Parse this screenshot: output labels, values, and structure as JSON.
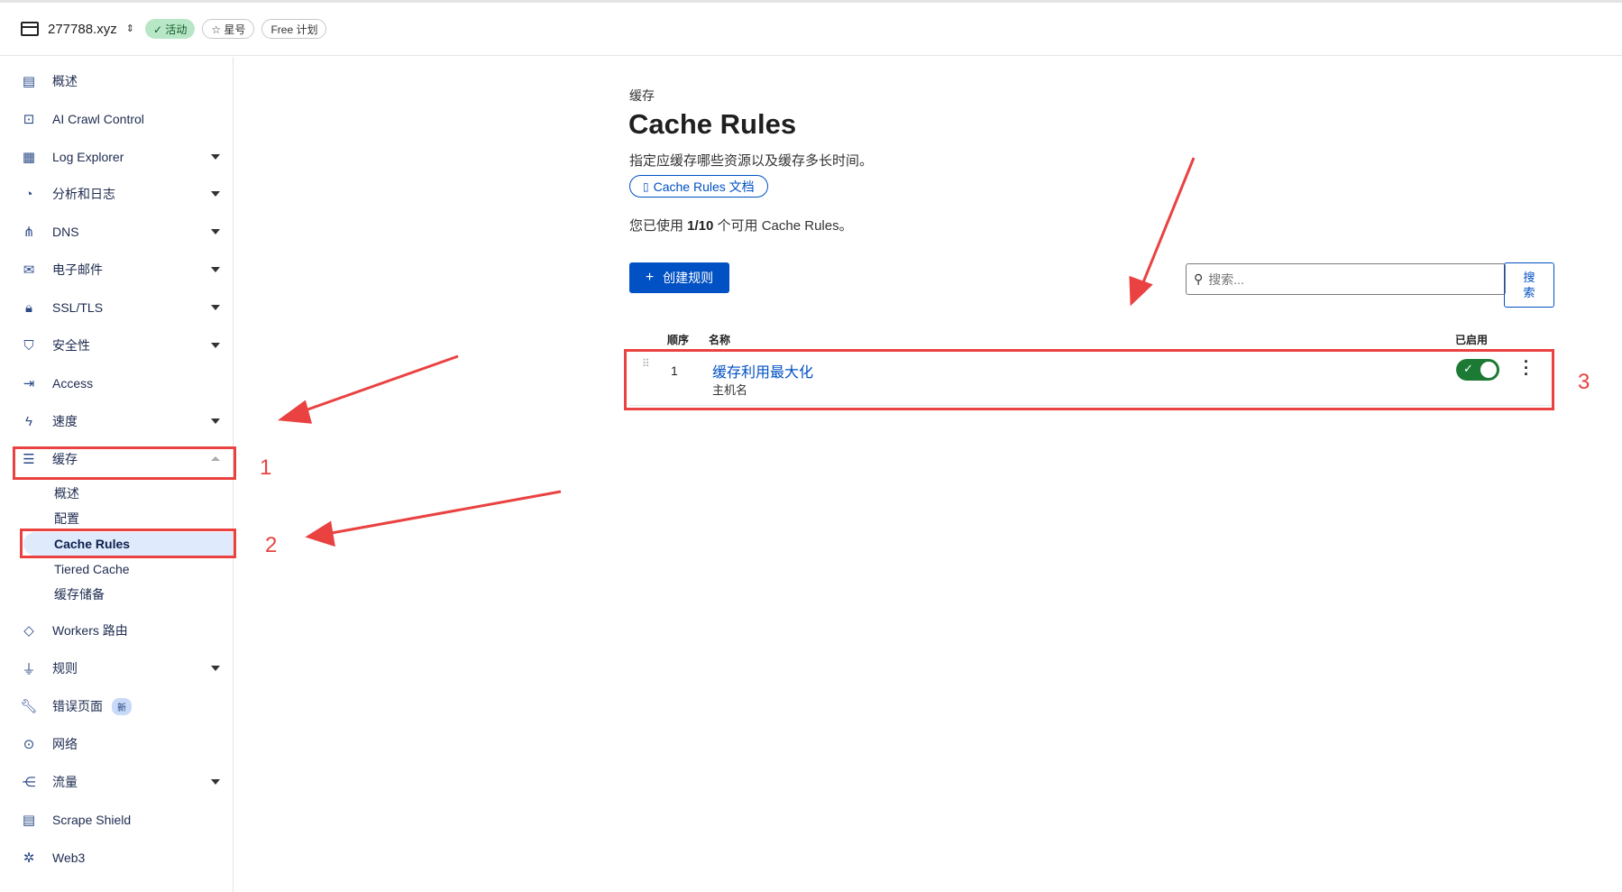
{
  "topbar": {
    "zone_name": "277788.xyz",
    "status_badge": "✓ 活动",
    "star_badge": "☆ 星号",
    "plan_badge": "Free 计划"
  },
  "sidebar": {
    "items": [
      {
        "label": "概述",
        "icon": "document-icon"
      },
      {
        "label": "AI Crawl Control",
        "icon": "robot-icon"
      },
      {
        "label": "Log Explorer",
        "icon": "log-icon"
      },
      {
        "label": "分析和日志",
        "icon": "chart-icon"
      },
      {
        "label": "DNS",
        "icon": "network-icon"
      },
      {
        "label": "电子邮件",
        "icon": "email-icon"
      },
      {
        "label": "SSL/TLS",
        "icon": "lock-icon"
      },
      {
        "label": "安全性",
        "icon": "shield-icon"
      },
      {
        "label": "Access",
        "icon": "access-icon"
      },
      {
        "label": "速度",
        "icon": "bolt-icon"
      },
      {
        "label": "缓存",
        "icon": "storage-icon"
      },
      {
        "label": "Workers 路由",
        "icon": "code-icon"
      },
      {
        "label": "规则",
        "icon": "funnel-icon"
      },
      {
        "label": "错误页面",
        "icon": "wrench-icon",
        "badge": "新"
      },
      {
        "label": "网络",
        "icon": "location-icon"
      },
      {
        "label": "流量",
        "icon": "traffic-icon"
      },
      {
        "label": "Scrape Shield",
        "icon": "page-icon"
      },
      {
        "label": "Web3",
        "icon": "web3-icon"
      }
    ],
    "cache_sub": [
      "概述",
      "配置",
      "Cache Rules",
      "Tiered Cache",
      "缓存储备"
    ]
  },
  "main": {
    "breadcrumb": "缓存",
    "title": "Cache Rules",
    "description": "指定应缓存哪些资源以及缓存多长时间。",
    "doc_link": "Cache Rules 文档",
    "usage_prefix": "您已使用 ",
    "usage_count": "1/10",
    "usage_suffix": " 个可用 Cache Rules。",
    "create_button": "创建规则",
    "search_placeholder": "搜索...",
    "search_button": "搜索",
    "table": {
      "headers": {
        "order": "顺序",
        "name": "名称",
        "enabled": "已启用"
      },
      "rows": [
        {
          "order": "1",
          "name": "缓存利用最大化",
          "subtitle": "主机名",
          "enabled": true
        }
      ]
    }
  },
  "annotations": [
    "1",
    "2",
    "3"
  ],
  "colors": {
    "accent": "#0051c3",
    "annotation": "#ea4141",
    "toggle_on": "#1c7a34",
    "active_badge": "#b7e7c6"
  }
}
